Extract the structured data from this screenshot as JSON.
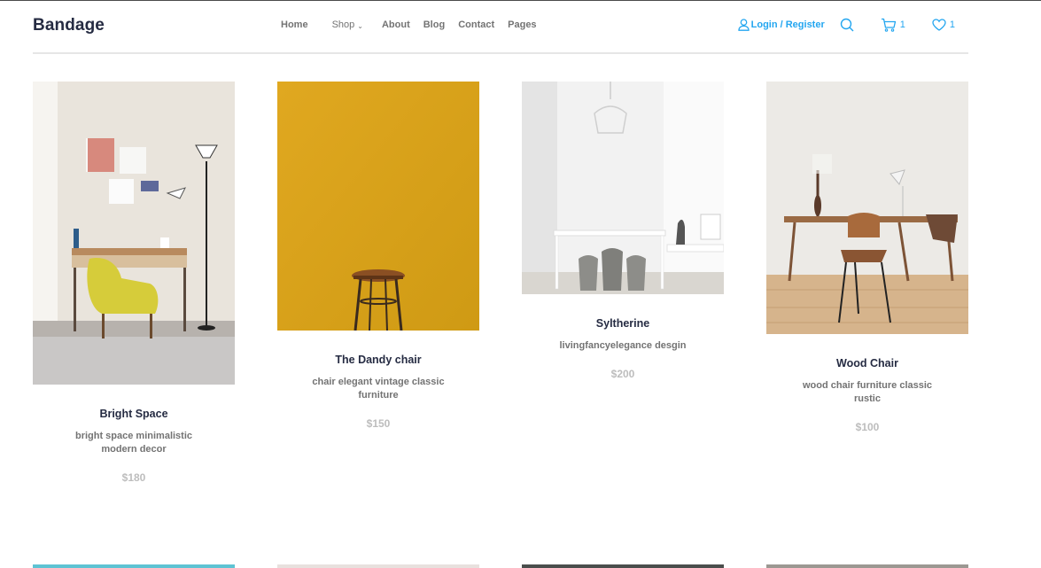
{
  "brand": "Bandage",
  "nav": {
    "home": "Home",
    "shop": "Shop",
    "about": "About",
    "blog": "Blog",
    "contact": "Contact",
    "pages": "Pages"
  },
  "account": {
    "login_label": "Login / Register",
    "cart_count": "1",
    "wishlist_count": "1"
  },
  "colors": {
    "accent": "#23A6F0",
    "heading": "#252B42",
    "muted": "#737373",
    "price": "#BDBDBD"
  },
  "products": [
    {
      "title": "Bright Space",
      "desc": "bright space minimalistic modern decor",
      "price": "$180"
    },
    {
      "title": "The Dandy chair",
      "desc": "chair elegant vintage classic furniture",
      "price": "$150"
    },
    {
      "title": "Syltherine",
      "desc": "livingfancyelegance desgin",
      "price": "$200"
    },
    {
      "title": "Wood Chair",
      "desc": "wood chair furniture classic rustic",
      "price": "$100"
    }
  ]
}
